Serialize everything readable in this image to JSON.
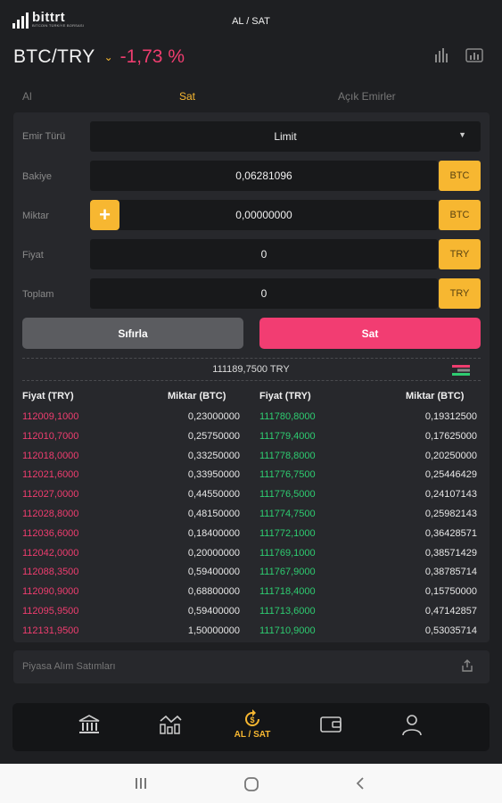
{
  "brand": {
    "name": "bittrt",
    "tagline": "BITCOIN TÜRKİYE BORSASI"
  },
  "header": {
    "title": "AL / SAT",
    "pair": "BTC/TRY",
    "change": "-1,73 %"
  },
  "header_icons": [
    "chart-bars-icon",
    "chart-screen-icon"
  ],
  "tabs": [
    {
      "label": "Al",
      "active": false
    },
    {
      "label": "Sat",
      "active": true
    },
    {
      "label": "Açık Emirler",
      "active": false
    }
  ],
  "form": {
    "order_type_label": "Emir Türü",
    "order_type_value": "Limit",
    "balance_label": "Bakiye",
    "balance_value": "0,06281096",
    "balance_unit": "BTC",
    "amount_label": "Miktar",
    "amount_value": "0,00000000",
    "amount_unit": "BTC",
    "price_label": "Fiyat",
    "price_value": "0",
    "price_unit": "TRY",
    "total_label": "Toplam",
    "total_value": "0",
    "total_unit": "TRY",
    "plus_label": "+",
    "reset_label": "Sıfırla",
    "sell_label": "Sat"
  },
  "orderbook": {
    "last_price": "111189,7500 TRY",
    "headers": [
      "Fiyat (TRY)",
      "Miktar (BTC)",
      "Fiyat (TRY)",
      "Miktar (BTC)"
    ],
    "rows": [
      [
        "112009,1000",
        "0,23000000",
        "111780,8000",
        "0,19312500"
      ],
      [
        "112010,7000",
        "0,25750000",
        "111779,4000",
        "0,17625000"
      ],
      [
        "112018,0000",
        "0,33250000",
        "111778,8000",
        "0,20250000"
      ],
      [
        "112021,6000",
        "0,33950000",
        "111776,7500",
        "0,25446429"
      ],
      [
        "112027,0000",
        "0,44550000",
        "111776,5000",
        "0,24107143"
      ],
      [
        "112028,8000",
        "0,48150000",
        "111774,7500",
        "0,25982143"
      ],
      [
        "112036,6000",
        "0,18400000",
        "111772,1000",
        "0,36428571"
      ],
      [
        "112042,0000",
        "0,20000000",
        "111769,1000",
        "0,38571429"
      ],
      [
        "112088,3500",
        "0,59400000",
        "111767,9000",
        "0,38785714"
      ],
      [
        "112090,9000",
        "0,68800000",
        "111718,4000",
        "0,15750000"
      ],
      [
        "112095,9500",
        "0,59400000",
        "111713,6000",
        "0,47142857"
      ],
      [
        "112131,9500",
        "1,50000000",
        "111710,9000",
        "0,53035714"
      ]
    ]
  },
  "market": {
    "label": "Piyasa Alım Satımları"
  },
  "nav": {
    "trade_label": "AL / SAT"
  },
  "colors": {
    "accent": "#f7b731",
    "sell": "#ee3d6f",
    "buy": "#2ecc71"
  }
}
